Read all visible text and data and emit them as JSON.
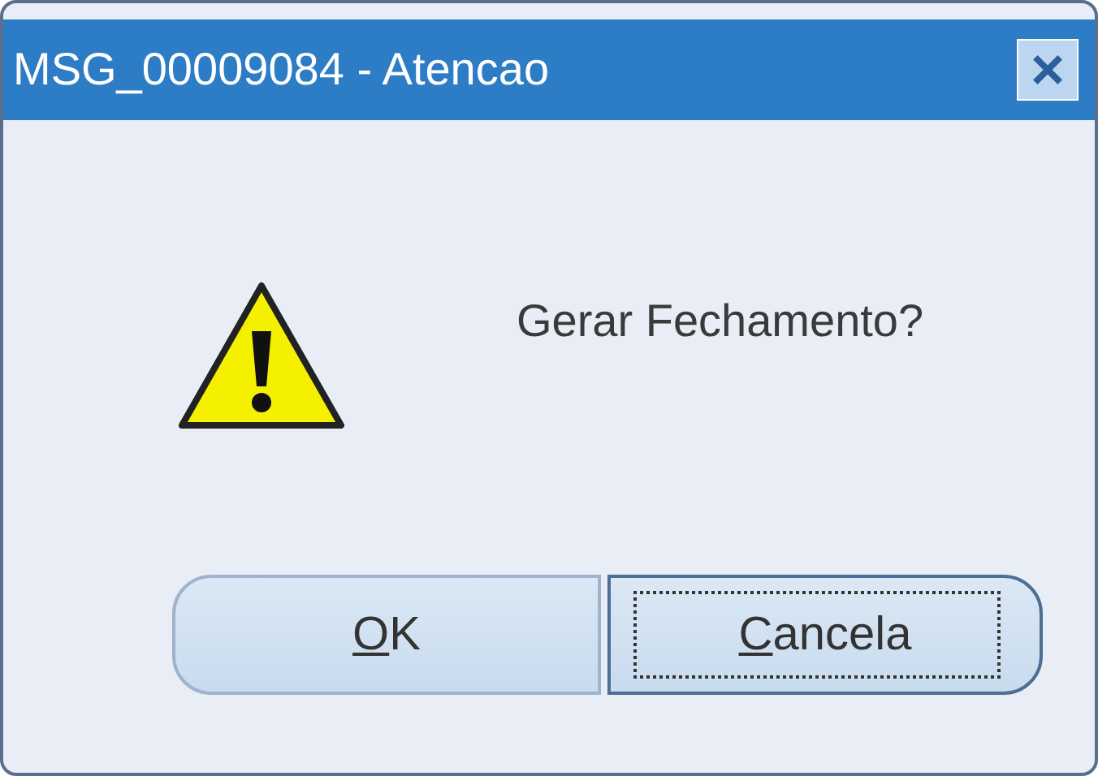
{
  "window": {
    "title": "MSG_00009084 - Atencao",
    "close": "×"
  },
  "message": {
    "kind": "warning",
    "text": "Gerar Fechamento?"
  },
  "buttons": [
    {
      "label": "OK",
      "focused": false,
      "mnemonic_underlined": true
    },
    {
      "label": "Cancela",
      "focused": true,
      "mnemonic_underlined": true
    }
  ]
}
